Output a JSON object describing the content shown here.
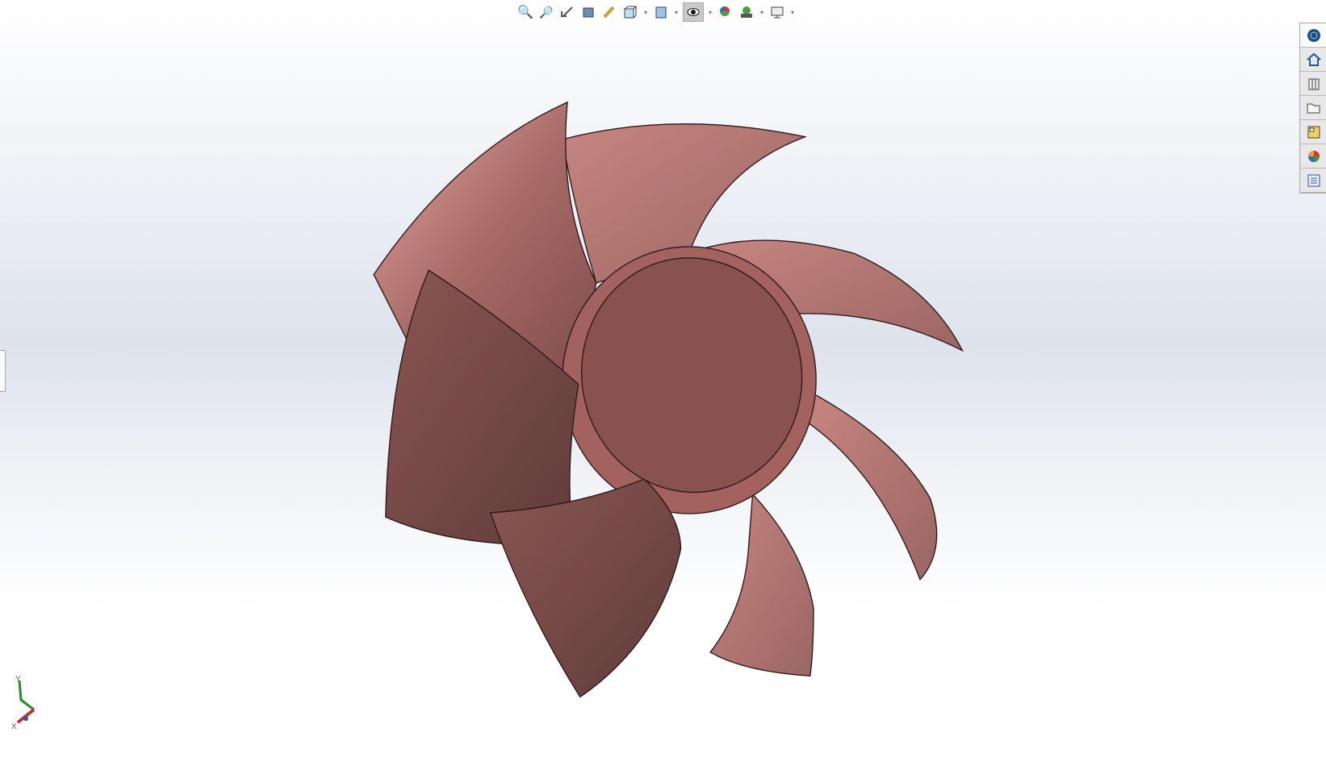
{
  "toolbar": {
    "items": [
      "zoom-to-fit",
      "zoom-to-area",
      "previous-view",
      "section-view",
      "dynamic-annotation-views",
      "view-orientation",
      "display-style",
      "hide-show-items",
      "edit-appearance",
      "apply-scene",
      "view-settings"
    ]
  },
  "task_pane": {
    "items": [
      "solidworks-resources",
      "home",
      "design-library",
      "file-explorer",
      "view-palette",
      "appearances-scenes-decals",
      "custom-properties"
    ]
  },
  "triad": {
    "y_label": "Y",
    "x_label": "X"
  },
  "model": {
    "color": "#9a5d5a"
  }
}
